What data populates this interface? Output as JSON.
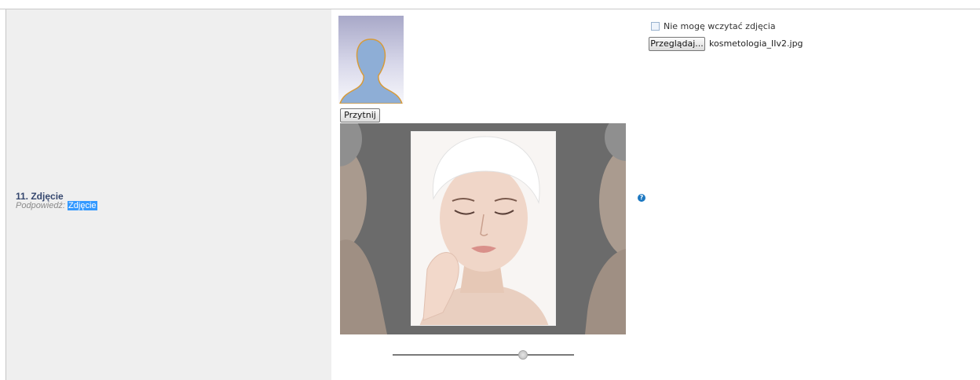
{
  "field": {
    "title": "11. Zdjęcie",
    "hint_label": "Podpowiedź: ",
    "hint_value": "Zdjęcie"
  },
  "avatar": {
    "icon": "user-silhouette-icon"
  },
  "crop_button": {
    "label": "Przytnij"
  },
  "crop_image": {
    "description": "woman-with-white-towel-photo"
  },
  "zoom_slider": {
    "value_fraction": 0.72
  },
  "help": {
    "icon": "question-mark-icon",
    "glyph": "?"
  },
  "upload": {
    "cant_load_label": "Nie mogę wczytać zdjęcia",
    "browse_label": "Przeglądaj...",
    "file_name": "kosmetologia_IIv2.jpg"
  },
  "colors": {
    "panel_bg": "#efefef",
    "title_color": "#35476e",
    "highlight": "#3399ff",
    "help_icon": "#1d78c1"
  }
}
